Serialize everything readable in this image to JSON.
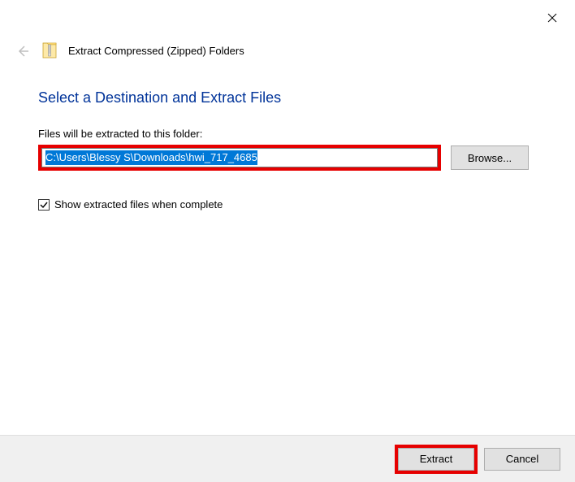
{
  "wizard_title": "Extract Compressed (Zipped) Folders",
  "page_title": "Select a Destination and Extract Files",
  "field_label": "Files will be extracted to this folder:",
  "destination_path": "C:\\Users\\Blessy S\\Downloads\\hwi_717_4685",
  "browse_label": "Browse...",
  "checkbox_label": "Show extracted files when complete",
  "checkbox_checked": true,
  "extract_label": "Extract",
  "cancel_label": "Cancel"
}
